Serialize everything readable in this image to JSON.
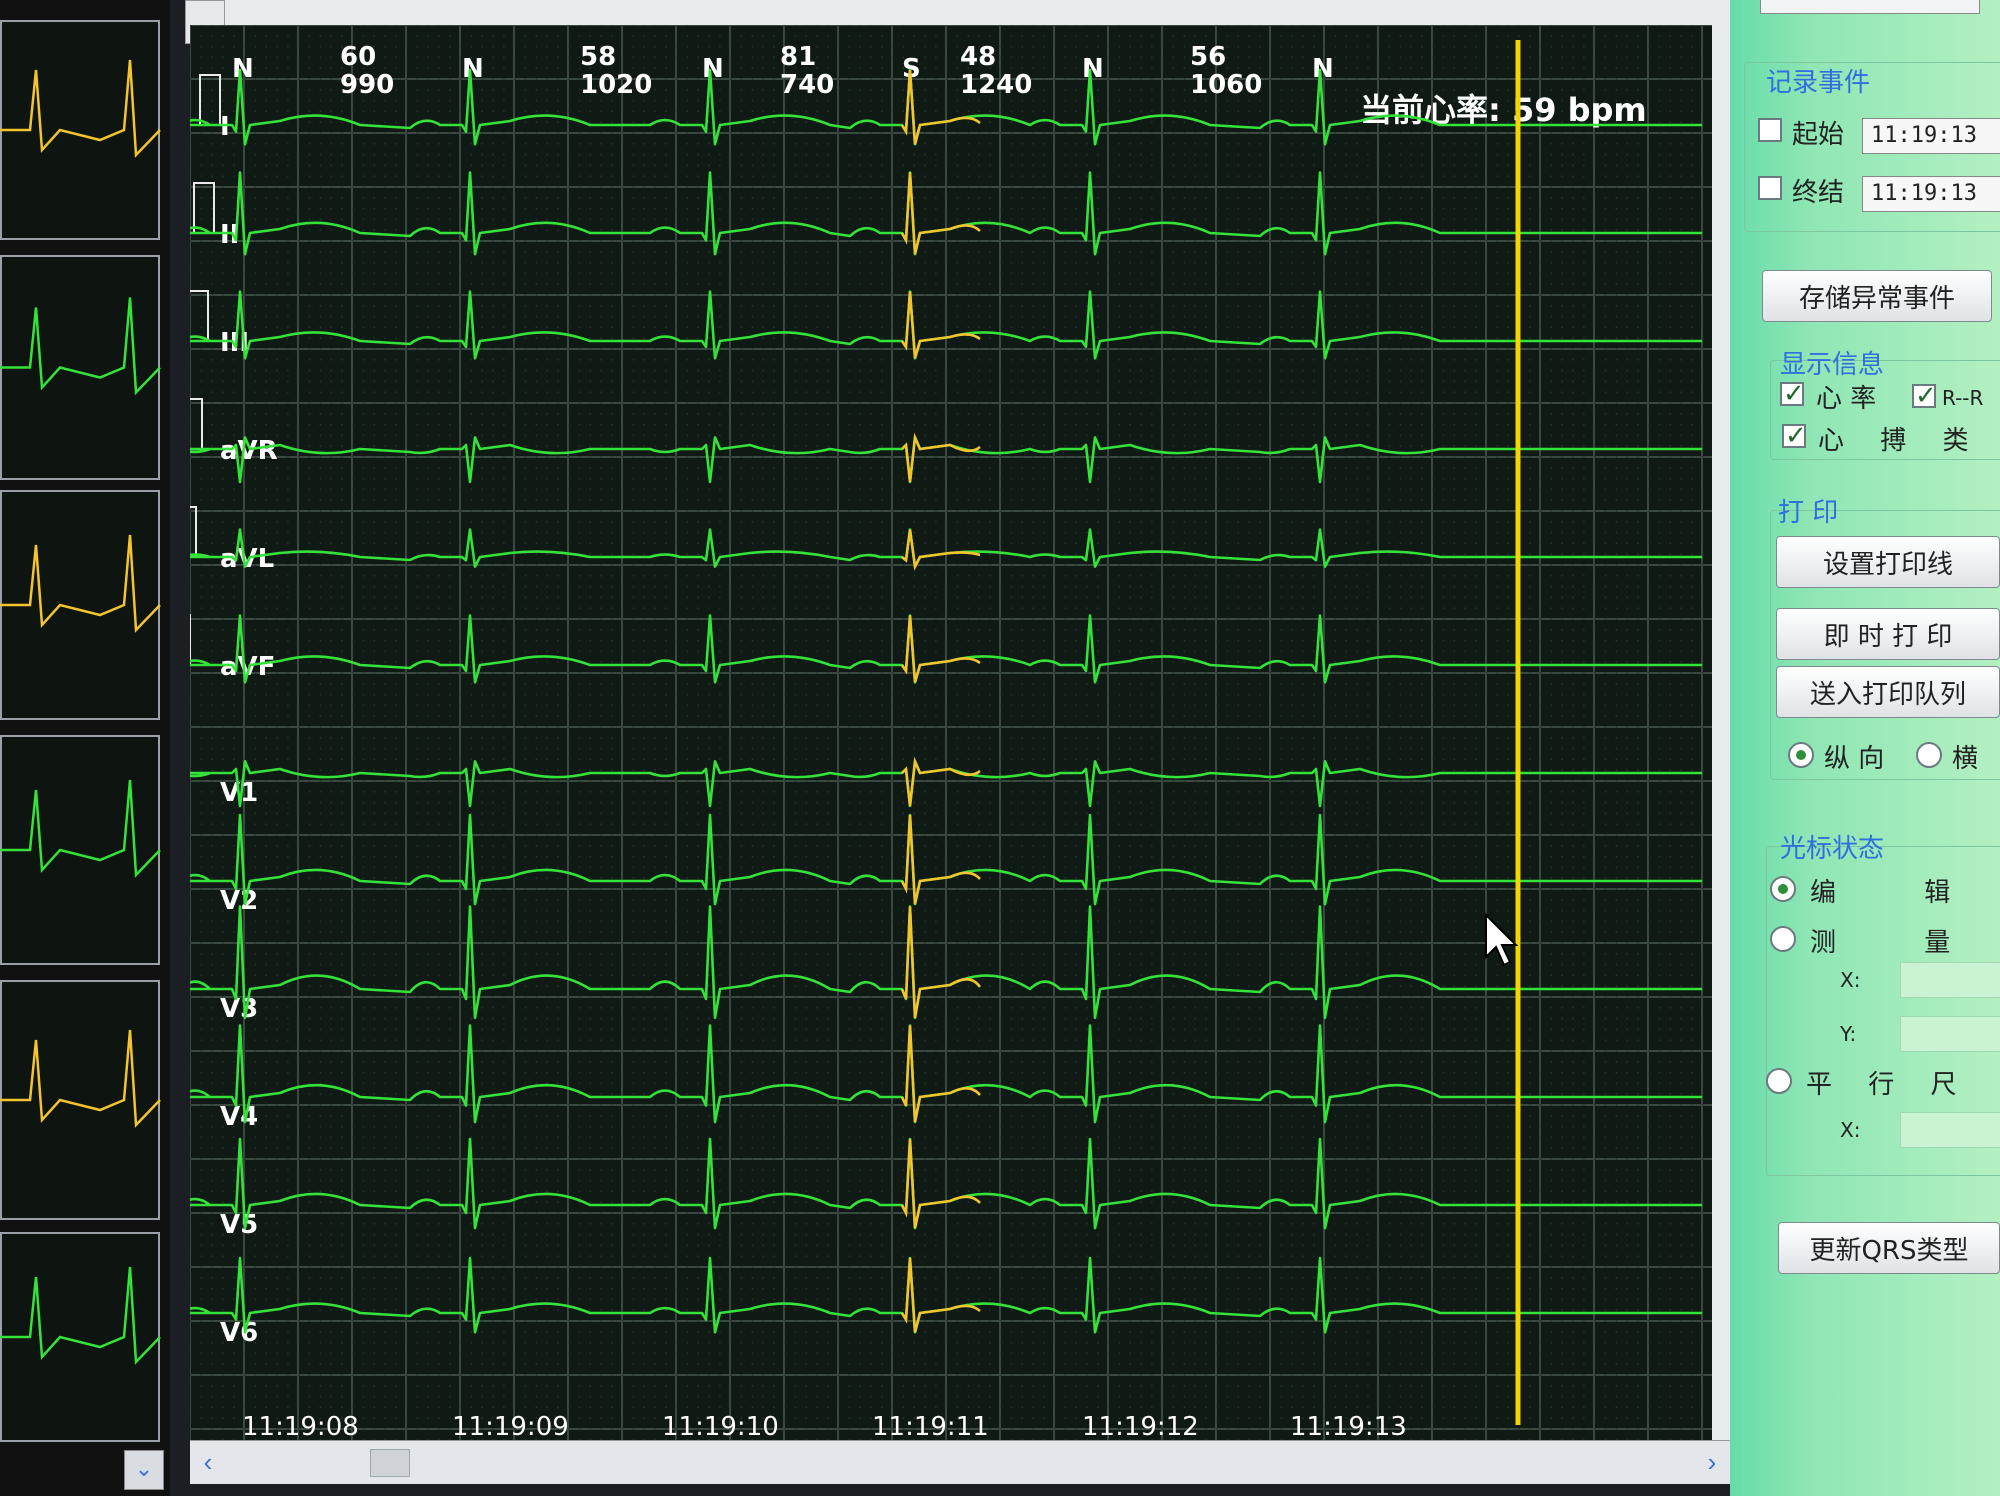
{
  "beats": [
    {
      "type": "N",
      "hr": "",
      "rr": ""
    },
    {
      "type": "N",
      "hr": "60",
      "rr": "990"
    },
    {
      "type": "N",
      "hr": "58",
      "rr": "1020"
    },
    {
      "type": "S",
      "hr": "81",
      "rr": "740"
    },
    {
      "type": "N",
      "hr": "48",
      "rr": "1240"
    },
    {
      "type": "N",
      "hr": "56",
      "rr": "1060"
    }
  ],
  "leads": [
    "I",
    "II",
    "III",
    "aVR",
    "aVL",
    "aVF",
    "V1",
    "V2",
    "V3",
    "V4",
    "V5",
    "V6"
  ],
  "time_labels": [
    "11:19:08",
    "11:19:09",
    "11:19:10",
    "11:19:11",
    "11:19:12",
    "11:19:13"
  ],
  "current_hr": "当前心率: 59 bpm",
  "colors": {
    "trace": "#35e23a",
    "highlight": "#f2c430",
    "cursor": "#f5d400",
    "grid": "#3a4a40",
    "panel_text": "#2f6fe0"
  },
  "panel": {
    "record_event": {
      "title": "记录事件",
      "start_label": "起始",
      "start_time": "11:19:13",
      "end_label": "终结",
      "end_time": "11:19:13"
    },
    "store_button": "存储异常事件",
    "display_info": {
      "title": "显示信息",
      "hr_label": "心 率",
      "rr_label": "R--R",
      "beat_type_label": "心 搏 类 型"
    },
    "print": {
      "title": "打 印",
      "set_line_button": "设置打印线",
      "print_now_button": "即 时 打 印",
      "queue_button": "送入打印队列",
      "portrait_label": "纵 向",
      "landscape_label": "横"
    },
    "cursor_state": {
      "title": "光标状态",
      "edit_label": "编 辑",
      "measure_label": "测 量",
      "x_label": "X:",
      "y_label": "Y:",
      "ruler_label": "平 行 尺",
      "ruler_x_label": "X:"
    },
    "update_qrs_button": "更新QRS类型"
  },
  "icons": {
    "scroll_left": "chevron-left-icon",
    "scroll_right": "chevron-right-icon",
    "scroll_down": "chevron-down-icon",
    "cursor": "mouse-pointer-icon"
  }
}
